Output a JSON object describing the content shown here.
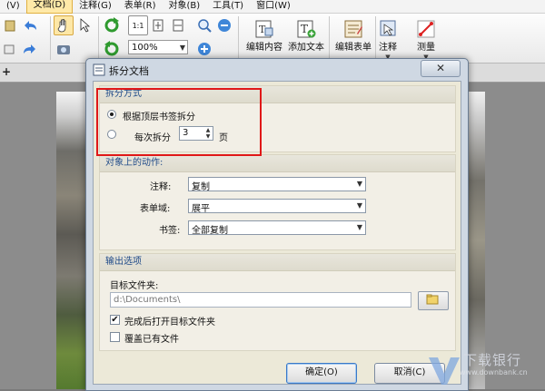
{
  "menu": {
    "items": [
      "(V)",
      "文档(D)",
      "注释(G)",
      "表单(R)",
      "对象(B)",
      "工具(T)",
      "窗口(W)"
    ]
  },
  "toolbar": {
    "zoom_value": "100%",
    "edit_content_label": "编辑内容",
    "add_text_label": "添加文本",
    "edit_form_label": "编辑表单",
    "comment_label": "注释",
    "measure_label": "测量",
    "fit_page_label": "1:1"
  },
  "dialog": {
    "title": "拆分文档",
    "close_label": "✕",
    "split_method": {
      "heading": "拆分方式",
      "option_bookmark_label": "根据顶层书签拆分",
      "option_every_label": "每次拆分",
      "every_value": "3",
      "every_unit": "页",
      "selected": "bookmark"
    },
    "actions": {
      "heading": "对象上的动作:",
      "comments_label": "注释:",
      "comments_value": "复制",
      "form_fields_label": "表单域:",
      "form_fields_value": "展平",
      "bookmarks_label": "书签:",
      "bookmarks_value": "全部复制"
    },
    "output": {
      "heading": "输出选项",
      "target_folder_label": "目标文件夹:",
      "target_folder_value": "d:\\Documents\\",
      "open_after_label": "完成后打开目标文件夹",
      "open_after_checked": true,
      "overwrite_label": "覆盖已有文件",
      "overwrite_checked": false
    },
    "ok_label": "确定(O)",
    "cancel_label": "取消(C)"
  },
  "watermark": {
    "text": "下载银行",
    "url": "www.downbank.cn"
  },
  "colors": {
    "highlight": "#e01818",
    "group_heading": "#1f4a88",
    "dialog_frame": "#cfd8e3"
  }
}
